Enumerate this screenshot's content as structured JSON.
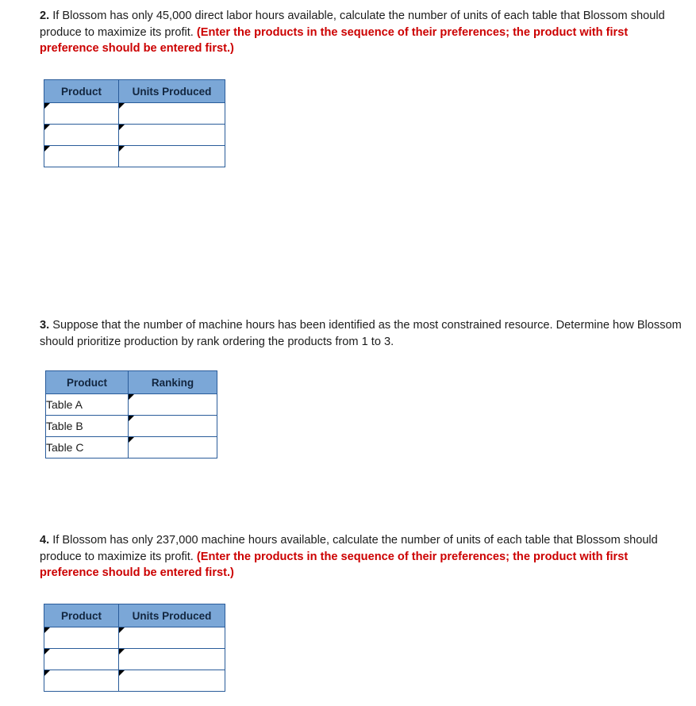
{
  "questions": [
    {
      "number": "2.",
      "text": " If Blossom has only 45,000 direct labor hours available, calculate the number of units of each table that Blossom should produce to maximize its profit. ",
      "emphasis": "(Enter the products in the sequence of their preferences; the product with first preference should be entered first.)",
      "table": {
        "headers": [
          "Product",
          "Units Produced"
        ],
        "rows": [
          {
            "product": "",
            "value": ""
          },
          {
            "product": "",
            "value": ""
          },
          {
            "product": "",
            "value": ""
          }
        ]
      }
    },
    {
      "number": "3.",
      "text": " Suppose that the number of machine hours has been identified as the most constrained resource. Determine how Blossom should prioritize production by rank ordering the products from 1 to 3.",
      "emphasis": "",
      "table": {
        "headers": [
          "Product",
          "Ranking"
        ],
        "rows": [
          {
            "product": "Table A",
            "value": ""
          },
          {
            "product": "Table B",
            "value": ""
          },
          {
            "product": "Table C",
            "value": ""
          }
        ]
      }
    },
    {
      "number": "4.",
      "text": " If Blossom has only 237,000 machine hours available, calculate the number of units of each table that Blossom should produce to maximize its profit. ",
      "emphasis": "(Enter the products in the sequence of their preferences; the product with first preference should be entered first.)",
      "table": {
        "headers": [
          "Product",
          "Units Produced"
        ],
        "rows": [
          {
            "product": "",
            "value": ""
          },
          {
            "product": "",
            "value": ""
          },
          {
            "product": "",
            "value": ""
          }
        ]
      }
    }
  ],
  "colors": {
    "header_fill": "#7ba7d7",
    "border": "#2a5c9a",
    "emphasis_text": "#cc0000"
  }
}
